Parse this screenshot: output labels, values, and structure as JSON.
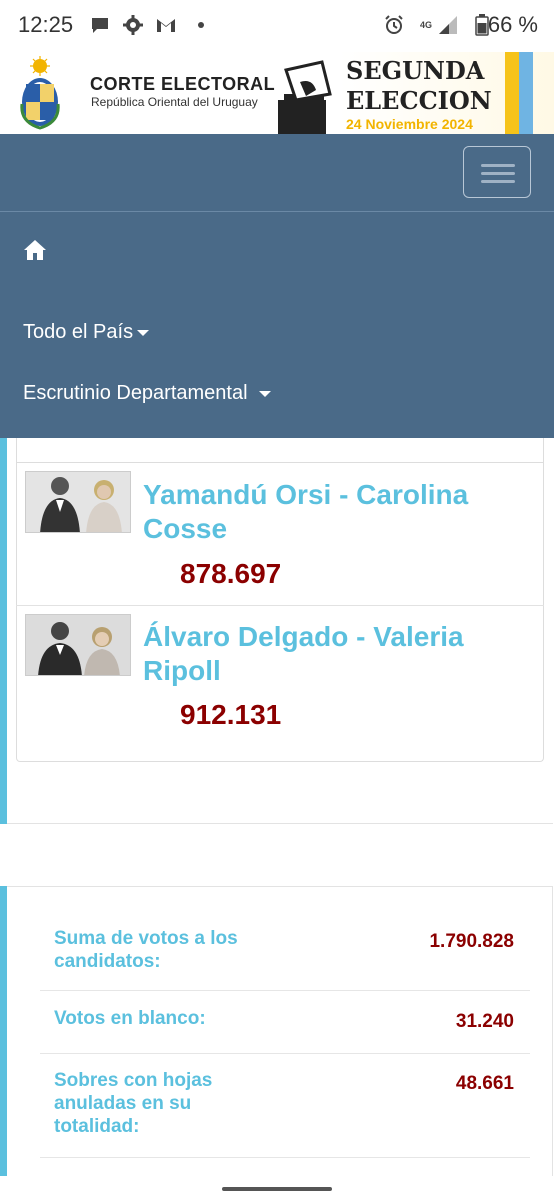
{
  "status_bar": {
    "time": "12:25",
    "battery": "66 %",
    "network": "4G",
    "icons": [
      "chat-bubble-icon",
      "gear-icon",
      "gmail-icon",
      "dot-icon",
      "alarm-icon",
      "signal-icon",
      "battery-icon"
    ]
  },
  "banner": {
    "court_title": "CORTE ELECTORAL",
    "court_subtitle": "República Oriental del Uruguay",
    "election_line1": "SEGUNDA",
    "election_line2": "ELECCION",
    "election_date": "24 Noviembre 2024"
  },
  "nav": {
    "items": [
      {
        "label": "Todo el País"
      },
      {
        "label": "Escrutinio Departamental"
      }
    ]
  },
  "candidates": [
    {
      "name": "Yamandú Orsi - Carolina Cosse",
      "votes": "878.697"
    },
    {
      "name": "Álvaro Delgado - Valeria Ripoll",
      "votes": "912.131"
    }
  ],
  "totals": [
    {
      "label": "Suma de votos a los candidatos:",
      "value": "1.790.828"
    },
    {
      "label": "Votos en blanco:",
      "value": "31.240"
    },
    {
      "label": "Sobres con hojas anuladas en su totalidad:",
      "value": "48.661"
    }
  ],
  "colors": {
    "navbar": "#4a6a88",
    "accent": "#5bc0de",
    "votes": "#8b0000",
    "flag_yellow": "#f6c31a",
    "flag_blue": "#6fb4e3"
  }
}
